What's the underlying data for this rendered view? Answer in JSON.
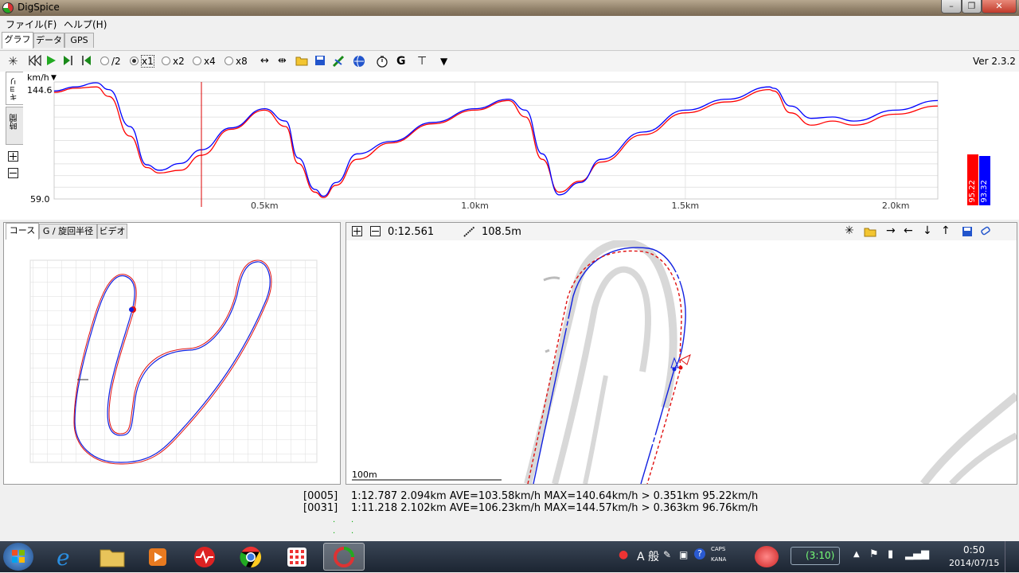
{
  "window": {
    "title": "DigSpice"
  },
  "menu": {
    "file": "ファイル(F)",
    "help": "ヘルプ(H)"
  },
  "main_tabs": [
    "グラフ",
    "データ",
    "GPS"
  ],
  "toolbar": {
    "speeds": [
      "/2",
      "x1",
      "x2",
      "x4",
      "x8"
    ],
    "selected_speed": "x1",
    "version": "Ver 2.3.2"
  },
  "graph": {
    "unit": "km/h",
    "side_tabs": [
      "キョリ",
      "時間"
    ],
    "legend": {
      "red": "95.22",
      "blue": "93.32"
    }
  },
  "chart_data": {
    "type": "line",
    "xlabel": "",
    "ylabel": "km/h",
    "ylim": [
      59.0,
      144.6
    ],
    "y_ticks": [
      "144.6",
      "59.0"
    ],
    "x_ticks": [
      "0.5km",
      "1.0km",
      "1.5km",
      "2.0km"
    ],
    "xlim": [
      0,
      2.1
    ],
    "cursor_x": 0.35,
    "series": [
      {
        "color": "#ff0000",
        "x": [
          0,
          0.05,
          0.1,
          0.13,
          0.18,
          0.22,
          0.25,
          0.3,
          0.35,
          0.42,
          0.5,
          0.55,
          0.58,
          0.62,
          0.64,
          0.67,
          0.72,
          0.8,
          0.9,
          1.0,
          1.08,
          1.12,
          1.16,
          1.2,
          1.25,
          1.3,
          1.4,
          1.5,
          1.6,
          1.7,
          1.71,
          1.75,
          1.8,
          1.85,
          1.9,
          2.0,
          2.1
        ],
        "y": [
          137,
          140,
          141,
          134,
          105,
          82,
          78,
          80,
          91,
          110,
          124,
          112,
          85,
          64,
          60,
          69,
          88,
          100,
          114,
          124,
          131,
          119,
          88,
          64,
          72,
          86,
          106,
          122,
          130,
          139,
          138,
          122,
          113,
          116,
          113,
          121,
          127
        ]
      },
      {
        "color": "#0000ff",
        "x": [
          0,
          0.05,
          0.1,
          0.13,
          0.18,
          0.22,
          0.25,
          0.3,
          0.35,
          0.42,
          0.5,
          0.55,
          0.58,
          0.62,
          0.64,
          0.67,
          0.72,
          0.8,
          0.9,
          1.0,
          1.08,
          1.12,
          1.16,
          1.2,
          1.25,
          1.3,
          1.4,
          1.5,
          1.6,
          1.7,
          1.71,
          1.75,
          1.8,
          1.85,
          1.9,
          2.0,
          2.1
        ],
        "y": [
          138,
          141,
          144,
          139,
          112,
          84,
          80,
          85,
          95,
          111,
          125,
          116,
          89,
          66,
          61,
          71,
          92,
          101,
          115,
          125,
          132,
          124,
          92,
          62,
          71,
          88,
          108,
          124,
          132,
          141,
          140,
          127,
          118,
          119,
          116,
          124,
          131
        ]
      }
    ]
  },
  "left_panel": {
    "tabs": [
      "コース",
      "G / 旋回半径",
      "ビデオ"
    ]
  },
  "right_panel": {
    "time": "0:12.561",
    "distance": "108.5m",
    "scale_label": "100m"
  },
  "laps": [
    {
      "id": "[0005]",
      "text": "1:12.787 2.094km AVE=103.58km/h MAX=140.64km/h > 0.351km 95.22km/h",
      "color": "#e00000"
    },
    {
      "id": "[0031]",
      "text": "1:11.218 2.102km AVE=106.23km/h MAX=144.57km/h > 0.363km 96.76km/h",
      "color": "#0000dd"
    }
  ],
  "taskbar": {
    "ime": "A 般",
    "caps": "CAPS",
    "kana": "KANA",
    "battery": "(3:10)",
    "time": "0:50",
    "date": "2014/07/15"
  }
}
